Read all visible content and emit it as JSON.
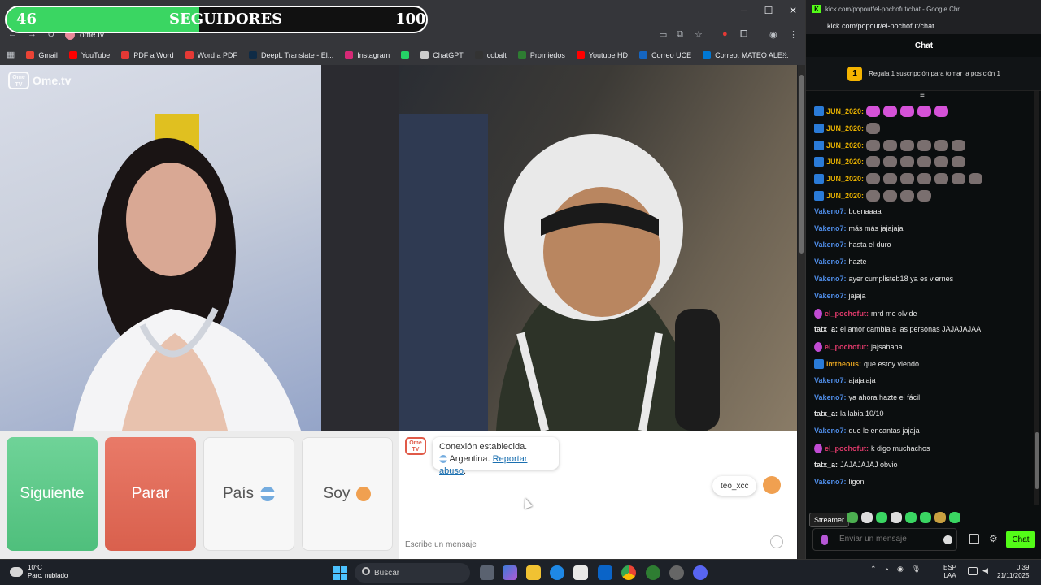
{
  "overlay": {
    "followers_current": "46",
    "followers_label": "SEGUIDORES",
    "followers_goal": "100",
    "progress_fraction": 0.46
  },
  "browser": {
    "address": "ome.tv",
    "bookmarks": [
      {
        "label": "Gmail",
        "color": "#ea4335"
      },
      {
        "label": "YouTube",
        "color": "#ff0000"
      },
      {
        "label": "PDF a Word",
        "color": "#e53935"
      },
      {
        "label": "Word a PDF",
        "color": "#e53935"
      },
      {
        "label": "DeepL Translate - El...",
        "color": "#0f2b46"
      },
      {
        "label": "Instagram",
        "color": "#d62976"
      },
      {
        "label": "",
        "color": "#25d366"
      },
      {
        "label": "ChatGPT",
        "color": "#cccccc"
      },
      {
        "label": "cobalt",
        "color": "#333333"
      },
      {
        "label": "Promiedos",
        "color": "#2e7d32"
      },
      {
        "label": "Youtube HD",
        "color": "#ff0000"
      },
      {
        "label": "Correo UCE",
        "color": "#1565c0"
      },
      {
        "label": "Correo: MATEO ALE...",
        "color": "#0078d4"
      }
    ]
  },
  "ometv": {
    "logo": "Ome.tv",
    "buttons": {
      "next": "Siguiente",
      "stop": "Parar",
      "country": "País",
      "gender": "Soy"
    },
    "system_message": {
      "line1": "Conexión establecida.",
      "country": "Argentina.",
      "report": "Reportar abuso"
    },
    "my_name": "teo_xcc",
    "input_placeholder": "Escribe un mensaje"
  },
  "kick": {
    "window_title": "kick.com/popout/el-pochofut/chat - Google Chr...",
    "url": "kick.com/popout/el-pochofut/chat",
    "header": "Chat",
    "gift_rank": "1",
    "gift_text": "Regala 1 suscripción para tomar la posición 1",
    "messages": [
      {
        "user": "JUN_2020:",
        "color": "#e8b100",
        "text": "",
        "badge": "blue",
        "emotes": "pink5"
      },
      {
        "user": "JUN_2020:",
        "color": "#e8b100",
        "text": "",
        "badge": "blue",
        "emotes": "grey1"
      },
      {
        "user": "JUN_2020:",
        "color": "#e8b100",
        "text": "",
        "badge": "blue",
        "emotes": "grey6"
      },
      {
        "user": "JUN_2020:",
        "color": "#e8b100",
        "text": "",
        "badge": "blue",
        "emotes": "grey6"
      },
      {
        "user": "JUN_2020:",
        "color": "#e8b100",
        "text": "",
        "badge": "blue",
        "emotes": "grey9"
      },
      {
        "user": "JUN_2020:",
        "color": "#e8b100",
        "text": "",
        "badge": "blue",
        "emotes": "grey4"
      },
      {
        "user": "Vakeno7:",
        "color": "#4f8de8",
        "text": "buenaaaa",
        "badge": "",
        "emotes": ""
      },
      {
        "user": "Vakeno7:",
        "color": "#4f8de8",
        "text": "más más jajajaja",
        "badge": "",
        "emotes": ""
      },
      {
        "user": "Vakeno7:",
        "color": "#4f8de8",
        "text": "hasta el duro",
        "badge": "",
        "emotes": ""
      },
      {
        "user": "Vakeno7:",
        "color": "#4f8de8",
        "text": "hazte",
        "badge": "",
        "emotes": ""
      },
      {
        "user": "Vakeno7:",
        "color": "#4f8de8",
        "text": "ayer cumplisteb18 ya es viernes",
        "badge": "",
        "emotes": ""
      },
      {
        "user": "Vakeno7:",
        "color": "#4f8de8",
        "text": "jajaja",
        "badge": "",
        "emotes": ""
      },
      {
        "user": "el_pochofut:",
        "color": "#e03a6b",
        "text": "mrd me olvide",
        "badge": "pink",
        "emotes": ""
      },
      {
        "user": "tatx_a:",
        "color": "#e6e6e6",
        "text": "el amor cambia a las personas JAJAJAJAA",
        "badge": "",
        "emotes": ""
      },
      {
        "user": "el_pochofut:",
        "color": "#e03a6b",
        "text": "jajsahaha",
        "badge": "pink",
        "emotes": ""
      },
      {
        "user": "imtheous:",
        "color": "#e0a020",
        "text": "que estoy viendo",
        "badge": "blue",
        "emotes": ""
      },
      {
        "user": "Vakeno7:",
        "color": "#4f8de8",
        "text": "ajajajaja",
        "badge": "",
        "emotes": ""
      },
      {
        "user": "Vakeno7:",
        "color": "#4f8de8",
        "text": "ya ahora hazte el fácil",
        "badge": "",
        "emotes": ""
      },
      {
        "user": "tatx_a:",
        "color": "#e6e6e6",
        "text": "la labia 10/10",
        "badge": "",
        "emotes": ""
      },
      {
        "user": "Vakeno7:",
        "color": "#4f8de8",
        "text": "que le encantas jajaja",
        "badge": "",
        "emotes": ""
      },
      {
        "user": "el_pochofut:",
        "color": "#e03a6b",
        "text": "k digo muchachos",
        "badge": "pink",
        "emotes": ""
      },
      {
        "user": "tatx_a:",
        "color": "#e6e6e6",
        "text": "JAJAJAJAJ obvio",
        "badge": "",
        "emotes": ""
      },
      {
        "user": "Vakeno7:",
        "color": "#4f8de8",
        "text": "ligon",
        "badge": "",
        "emotes": ""
      }
    ],
    "streamer_tag": "Streamer",
    "input_placeholder": "Enviar un mensaje",
    "chat_button": "Chat"
  },
  "taskbar": {
    "temp": "10°C",
    "weather": "Parc. nublado",
    "search": "Buscar",
    "lang1": "ESP",
    "lang2": "LAA",
    "time": "0:39",
    "date": "21/11/2025"
  }
}
